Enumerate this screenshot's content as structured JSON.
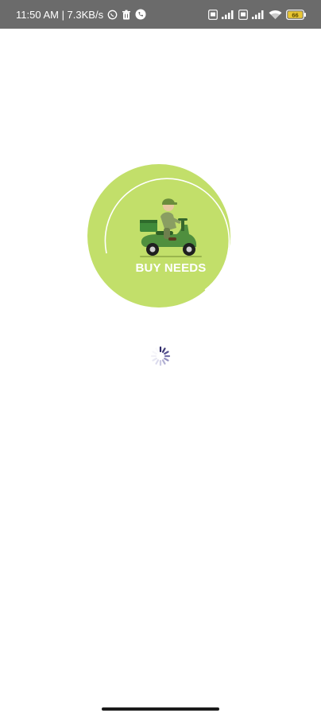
{
  "status_bar": {
    "time_speed": "11:50 AM | 7.3KB/s",
    "icons": [
      "whatsapp-icon",
      "trash-icon",
      "phone-icon",
      "sim-badge-icon",
      "signal-icon",
      "sim-badge-icon",
      "signal-icon",
      "wifi-icon",
      "battery-icon"
    ],
    "battery_level": "66"
  },
  "splash": {
    "brand_name": "BUY NEEDS",
    "brand_color": "#c2df6a",
    "illustration": "delivery-scooter-rider"
  },
  "loading": {
    "indicator": "spinner-icon"
  }
}
